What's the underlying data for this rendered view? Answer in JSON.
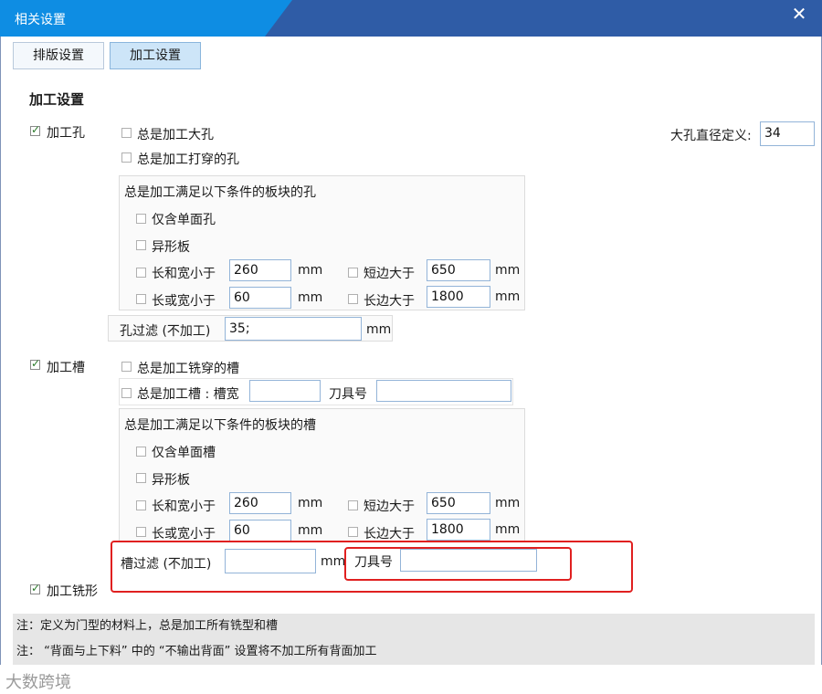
{
  "window": {
    "title": "相关设置",
    "close_glyph": "✕"
  },
  "tabs": [
    {
      "label": "排版设置",
      "active": false
    },
    {
      "label": "加工设置",
      "active": true
    }
  ],
  "section_title": "加工设置",
  "hole": {
    "label": "加工孔",
    "checked": true,
    "always_big": "总是加工大孔",
    "always_through": "总是加工打穿的孔",
    "big_diameter_label": "大孔直径定义:",
    "big_diameter_value": "34",
    "cond_title": "总是加工满足以下条件的板块的孔",
    "single_face": "仅含单面孔",
    "irregular": "异形板",
    "lw_less_label": "长和宽小于",
    "lw_less_value": "260",
    "lw_or_less_label": "长或宽小于",
    "lw_or_less_value": "60",
    "short_gt_label": "短边大于",
    "short_gt_value": "650",
    "long_gt_label": "长边大于",
    "long_gt_value": "1800",
    "unit": "mm",
    "filter_label": "孔过滤 (不加工)",
    "filter_value": "35;"
  },
  "slot": {
    "label": "加工槽",
    "checked": true,
    "always_mill_through": "总是加工铣穿的槽",
    "always_slot_label": "总是加工槽 : 槽宽",
    "slot_width_value": "",
    "tool_label": "刀具号",
    "tool_value": "",
    "cond_title": "总是加工满足以下条件的板块的槽",
    "single_face": "仅含单面槽",
    "irregular": "异形板",
    "lw_less_label": "长和宽小于",
    "lw_less_value": "260",
    "lw_or_less_label": "长或宽小于",
    "lw_or_less_value": "60",
    "short_gt_label": "短边大于",
    "short_gt_value": "650",
    "long_gt_label": "长边大于",
    "long_gt_value": "1800",
    "unit": "mm",
    "filter_label": "槽过滤 (不加工)",
    "filter_value": "",
    "filter_unit": "mm",
    "filter_tool_label": "刀具号",
    "filter_tool_value": ""
  },
  "mill": {
    "label": "加工铣形",
    "checked": true
  },
  "notes": [
    "注：定义为门型的材料上，总是加工所有铣型和槽",
    "注：  “背面与上下料”  中的 “不输出背面” 设置将不加工所有背面加工"
  ],
  "watermark": "大数跨境",
  "colors": {
    "title_bar": "#2f5ca6",
    "title_accent": "#0e8de3",
    "active_tab": "#cde5f8",
    "highlight": "#e02020"
  }
}
